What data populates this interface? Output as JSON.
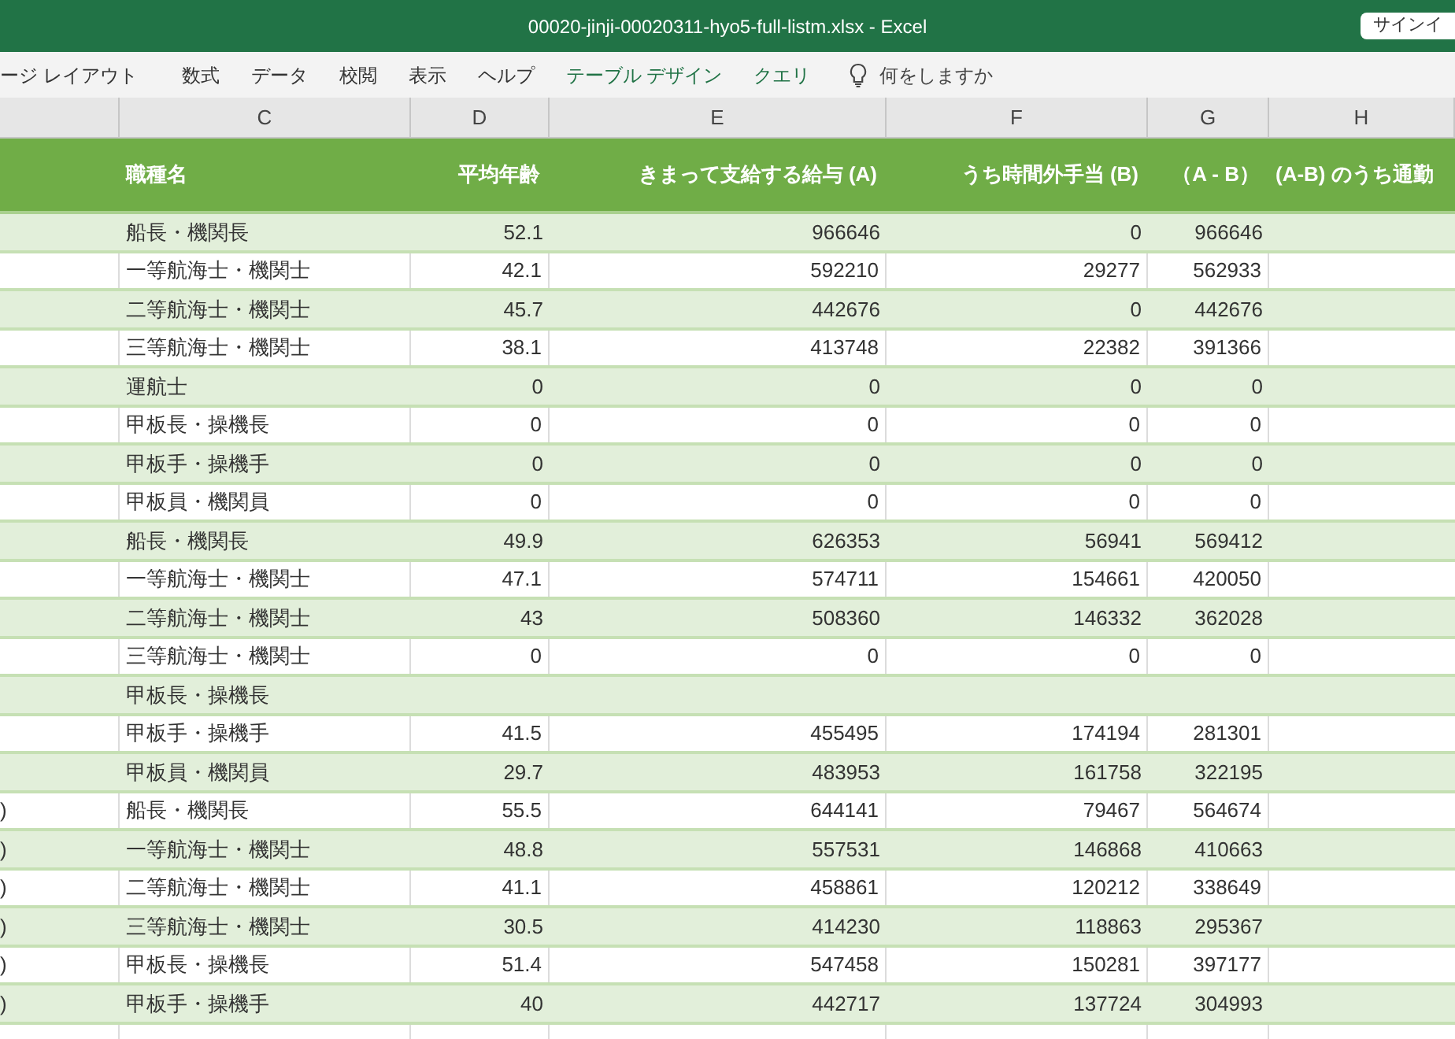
{
  "window": {
    "title": "00020-jinji-00020311-hyo5-full-listm.xlsx  -  Excel",
    "sign_in": "サインイ"
  },
  "ribbon_tabs": [
    {
      "label": "ージ レイアウト",
      "kind": "normal"
    },
    {
      "label": "数式",
      "kind": "normal"
    },
    {
      "label": "データ",
      "kind": "normal"
    },
    {
      "label": "校閲",
      "kind": "normal"
    },
    {
      "label": "表示",
      "kind": "normal"
    },
    {
      "label": "ヘルプ",
      "kind": "normal"
    },
    {
      "label": "テーブル デザイン",
      "kind": "contextual"
    },
    {
      "label": "クエリ",
      "kind": "contextual"
    }
  ],
  "search": {
    "placeholder": "何をしますか"
  },
  "column_letters": [
    "C",
    "D",
    "E",
    "F",
    "G",
    "H"
  ],
  "table": {
    "columns": [
      "職種名",
      "平均年齢",
      "きまって支給する給与 (A)",
      "うち時間外手当 (B)",
      "（A - B）",
      "(A-B) のうち通勤"
    ],
    "rows": [
      {
        "job": "船長・機関長",
        "age": "52.1",
        "a": "966646",
        "b": "0",
        "ab": "966646"
      },
      {
        "job": "一等航海士・機関士",
        "age": "42.1",
        "a": "592210",
        "b": "29277",
        "ab": "562933"
      },
      {
        "job": "二等航海士・機関士",
        "age": "45.7",
        "a": "442676",
        "b": "0",
        "ab": "442676"
      },
      {
        "job": "三等航海士・機関士",
        "age": "38.1",
        "a": "413748",
        "b": "22382",
        "ab": "391366"
      },
      {
        "job": "運航士",
        "age": "0",
        "a": "0",
        "b": "0",
        "ab": "0"
      },
      {
        "job": "甲板長・操機長",
        "age": "0",
        "a": "0",
        "b": "0",
        "ab": "0"
      },
      {
        "job": "甲板手・操機手",
        "age": "0",
        "a": "0",
        "b": "0",
        "ab": "0"
      },
      {
        "job": "甲板員・機関員",
        "age": "0",
        "a": "0",
        "b": "0",
        "ab": "0"
      },
      {
        "job": "船長・機関長",
        "age": "49.9",
        "a": "626353",
        "b": "56941",
        "ab": "569412"
      },
      {
        "job": "一等航海士・機関士",
        "age": "47.1",
        "a": "574711",
        "b": "154661",
        "ab": "420050"
      },
      {
        "job": "二等航海士・機関士",
        "age": "43",
        "a": "508360",
        "b": "146332",
        "ab": "362028"
      },
      {
        "job": "三等航海士・機関士",
        "age": "0",
        "a": "0",
        "b": "0",
        "ab": "0"
      },
      {
        "job": "甲板長・操機長"
      },
      {
        "job": "甲板手・操機手",
        "age": "41.5",
        "a": "455495",
        "b": "174194",
        "ab": "281301"
      },
      {
        "job": "甲板員・機関員",
        "age": "29.7",
        "a": "483953",
        "b": "161758",
        "ab": "322195"
      },
      {
        "col_b": ")",
        "job": "船長・機関長",
        "age": "55.5",
        "a": "644141",
        "b": "79467",
        "ab": "564674"
      },
      {
        "col_b": ")",
        "job": "一等航海士・機関士",
        "age": "48.8",
        "a": "557531",
        "b": "146868",
        "ab": "410663"
      },
      {
        "col_b": ")",
        "job": "二等航海士・機関士",
        "age": "41.1",
        "a": "458861",
        "b": "120212",
        "ab": "338649"
      },
      {
        "col_b": ")",
        "job": "三等航海士・機関士",
        "age": "30.5",
        "a": "414230",
        "b": "118863",
        "ab": "295367"
      },
      {
        "col_b": ")",
        "job": "甲板長・操機長",
        "age": "51.4",
        "a": "547458",
        "b": "150281",
        "ab": "397177"
      },
      {
        "col_b": ")",
        "job": "甲板手・操機手",
        "age": "40",
        "a": "442717",
        "b": "137724",
        "ab": "304993"
      }
    ]
  }
}
